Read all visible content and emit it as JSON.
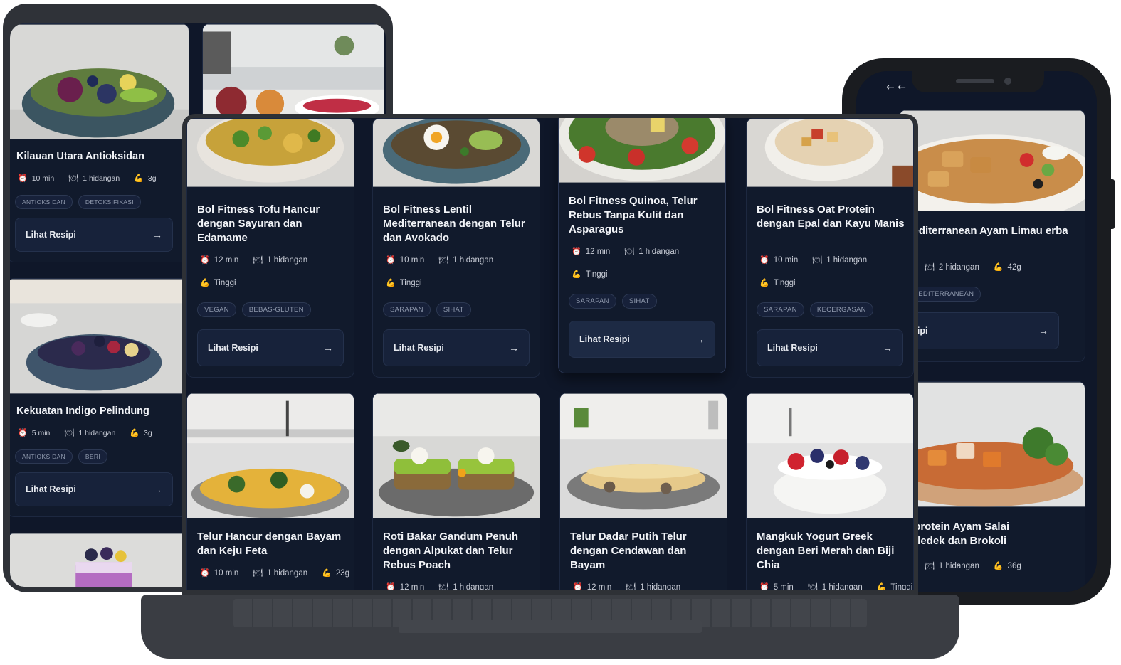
{
  "labels": {
    "view_recipe": "Lihat Resipi",
    "arrow": "→",
    "back_arrow": "← ←"
  },
  "icons": {
    "time": "timer-icon",
    "servings": "plate-icon",
    "protein": "muscle-icon"
  },
  "laptop": {
    "cards": [
      {
        "title": "Bol Fitness Tofu Hancur dengan Sayuran dan Edamame",
        "time": "12 min",
        "servings": "1 hidangan",
        "protein": "Tinggi",
        "tags": [
          "VEGAN",
          "BEBAS-GLUTEN"
        ]
      },
      {
        "title": "Bol Fitness Lentil Mediterranean dengan Telur dan Avokado",
        "time": "10 min",
        "servings": "1 hidangan",
        "protein": "Tinggi",
        "tags": [
          "SARAPAN",
          "SIHAT"
        ]
      },
      {
        "title": "Bol Fitness Quinoa, Telur Rebus Tanpa Kulit dan Asparagus",
        "time": "12 min",
        "servings": "1 hidangan",
        "protein": "Tinggi",
        "tags": [
          "SARAPAN",
          "SIHAT"
        ]
      },
      {
        "title": "Bol Fitness Oat Protein dengan Epal dan Kayu Manis",
        "time": "10 min",
        "servings": "1 hidangan",
        "protein": "Tinggi",
        "tags": [
          "SARAPAN",
          "KECERGASAN"
        ]
      },
      {
        "title": "Telur Hancur dengan Bayam dan Keju Feta",
        "time": "10 min",
        "servings": "1 hidangan",
        "protein": "23g"
      },
      {
        "title": "Roti Bakar Gandum Penuh dengan Alpukat dan Telur Rebus Poach",
        "time": "12 min",
        "servings": "1 hidangan"
      },
      {
        "title": "Telur Dadar Putih Telur dengan Cendawan dan Bayam",
        "time": "12 min",
        "servings": "1 hidangan"
      },
      {
        "title": "Mangkuk Yogurt Greek dengan Beri Merah dan Biji Chia",
        "time": "5 min",
        "servings": "1 hidangan",
        "protein": "Tinggi"
      }
    ]
  },
  "tablet": {
    "cards": [
      {
        "title": "Kilauan Utara Antioksidan",
        "time": "10 min",
        "servings": "1 hidangan",
        "protein": "3g",
        "tags": [
          "ANTIOKSIDAN",
          "DETOKSIFIKASI"
        ]
      },
      {
        "title": "Kekuatan Indigo Pelindung",
        "time": "5 min",
        "servings": "1 hidangan",
        "protein": "3g",
        "tags": [
          "ANTIOKSIDAN",
          "BERI"
        ]
      }
    ]
  },
  "phone": {
    "cards": [
      {
        "title": "Mediterranean Ayam Limau erba",
        "time": "in",
        "servings": "2 hidangan",
        "protein": "42g",
        "tags": [
          "MEDITERRANEAN"
        ],
        "button": "esipi"
      },
      {
        "title": "erprotein Ayam Salai Keledek dan Brokoli",
        "time": "in",
        "servings": "1 hidangan",
        "protein": "36g"
      }
    ]
  },
  "colors": {
    "background": "#0f1729",
    "card": "#111a2c",
    "button": "#17223a",
    "text": "#f2f4f8",
    "muted": "#c8ccd6"
  }
}
